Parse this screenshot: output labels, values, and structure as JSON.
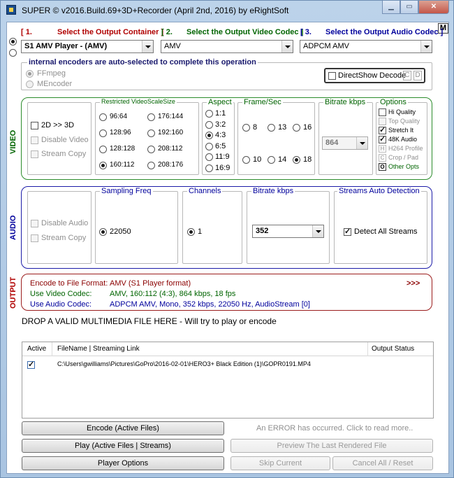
{
  "window": {
    "title": "SUPER © v2016.Build.69+3D+Recorder (April 2nd, 2016) by eRightSoft",
    "corner_btn": "M"
  },
  "selectors": {
    "container": {
      "num": "[ 1.",
      "label": "Select the Output Container ]",
      "value": "S1 AMV  Player - (AMV)"
    },
    "video_codec": {
      "num": "[ 2.",
      "label": "Select the Output Video Codec ]",
      "value": "AMV"
    },
    "audio_codec": {
      "num": "[ 3.",
      "label": "Select the Output Audio Codec ]",
      "value": "ADPCM AMV"
    }
  },
  "encoders": {
    "title": "internal encoders are auto-selected to complete this operation",
    "options": [
      "FFmpeg",
      "MEncoder"
    ],
    "selected": "FFmpeg",
    "directshow": "DirectShow Decode",
    "btn_c": "C",
    "btn_d": "D"
  },
  "video": {
    "section_label": "VIDEO",
    "left": {
      "d3": "2D >> 3D",
      "disable": "Disable Video",
      "copy": "Stream Copy"
    },
    "scale": {
      "title": "Restricted  VideoScaleSize",
      "options": [
        "96:64",
        "176:144",
        "128:96",
        "192:160",
        "128:128",
        "208:112",
        "160:112",
        "208:176"
      ],
      "selected": "160:112"
    },
    "aspect": {
      "title": "Aspect",
      "options": [
        "1:1",
        "3:2",
        "4:3",
        "6:5",
        "11:9",
        "16:9"
      ],
      "selected": "4:3"
    },
    "fps": {
      "title": "Frame/Sec",
      "options": [
        "8",
        "13",
        "16",
        "10",
        "14",
        "18"
      ],
      "selected": "18"
    },
    "bitrate": {
      "title": "Bitrate  kbps",
      "value": "864"
    },
    "options": {
      "title": "Options",
      "hi_quality": "Hi Quality",
      "top_quality": "Top Quality",
      "stretch": "Stretch It",
      "audio48k": "48K Audio",
      "h264": "H264 Profile",
      "crop": "Crop / Pad",
      "h_box": "H",
      "c_box": "C",
      "o_box": "O",
      "other": "Other Opts"
    }
  },
  "audio": {
    "section_label": "AUDIO",
    "left": {
      "disable": "Disable Audio",
      "copy": "Stream Copy"
    },
    "sampling": {
      "title": "Sampling Freq",
      "value": "22050"
    },
    "channels": {
      "title": "Channels",
      "value": "1"
    },
    "bitrate": {
      "title": "Bitrate  kbps",
      "value": "352"
    },
    "streams": {
      "title": "Streams Auto Detection",
      "detect": "Detect All Streams"
    }
  },
  "output": {
    "section_label": "OUTPUT",
    "format_label": "Encode to File Format:",
    "format_value": "AMV (S1 Player format)",
    "more": ">>>",
    "vcodec_label": "Use Video Codec:",
    "vcodec_value": "AMV,  160:112 (4:3),  864 kbps,  18 fps",
    "acodec_label": "Use Audio Codec:",
    "acodec_value": "ADPCM AMV,  Mono,  352 kbps,  22050 Hz,  AudioStream [0]"
  },
  "drop_text": "DROP A VALID MULTIMEDIA FILE HERE - Will try to play or encode",
  "files": {
    "headers": {
      "active": "Active",
      "filename": "FileName  |  Streaming Link",
      "status": "Output Status"
    },
    "rows": [
      {
        "path": "C:\\Users\\gwilliams\\Pictures\\GoPro\\2016-02-01\\HERO3+ Black Edition (1)\\GOPR0191.MP4",
        "status": ""
      }
    ]
  },
  "buttons": {
    "encode": "Encode (Active Files)",
    "play": "Play (Active Files | Streams)",
    "player_options": "Player Options",
    "error": "An ERROR has occurred. Click to read more..",
    "preview": "Preview The Last Rendered File",
    "skip": "Skip Current",
    "cancel": "Cancel All   /   Reset"
  }
}
